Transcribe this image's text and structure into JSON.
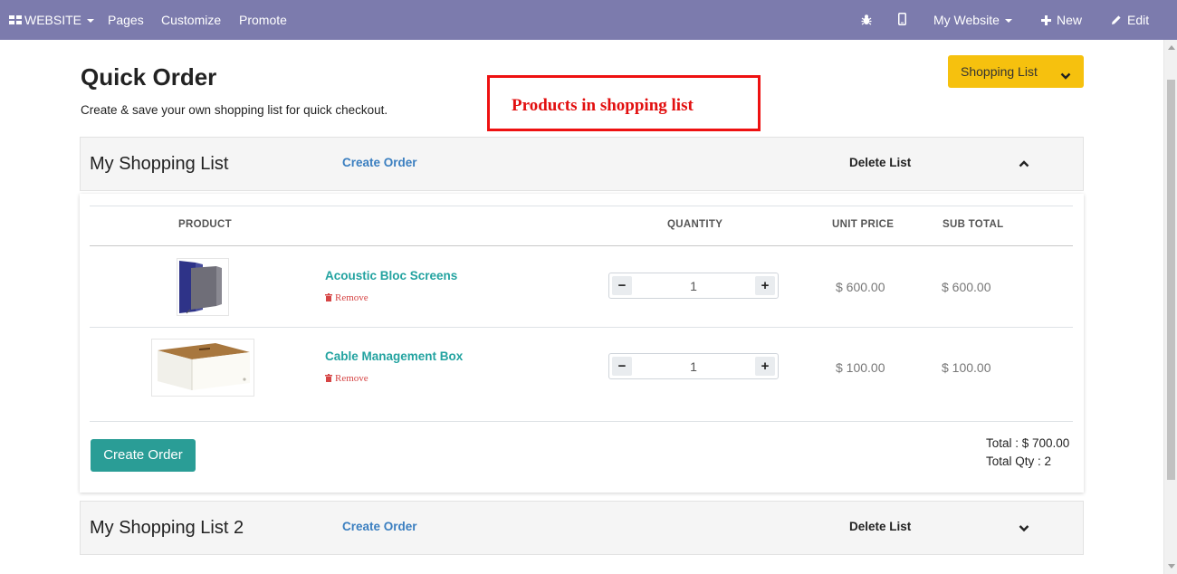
{
  "topbar": {
    "website_label": "WEBSITE",
    "menu": [
      "Pages",
      "Customize",
      "Promote"
    ],
    "my_website": "My Website",
    "new_label": "New",
    "edit_label": "Edit"
  },
  "page": {
    "title": "Quick Order",
    "subtitle": "Create & save your own shopping list for quick checkout.",
    "annotation": "Products in shopping list",
    "shopping_list_button": "Shopping List"
  },
  "lists": [
    {
      "name": "My Shopping List",
      "create_order": "Create Order",
      "delete_list": "Delete List",
      "expanded": true
    },
    {
      "name": "My Shopping List 2",
      "create_order": "Create Order",
      "delete_list": "Delete List",
      "expanded": false
    }
  ],
  "table": {
    "headers": {
      "product": "PRODUCT",
      "quantity": "QUANTITY",
      "unit_price": "UNIT PRICE",
      "sub_total": "SUB TOTAL"
    },
    "rows": [
      {
        "name": "Acoustic Bloc Screens",
        "remove": "Remove",
        "quantity": "1",
        "unit_price": "$ 600.00",
        "sub_total": "$ 600.00",
        "image_icon": "acoustic-screens-image"
      },
      {
        "name": "Cable Management Box",
        "remove": "Remove",
        "quantity": "1",
        "unit_price": "$ 100.00",
        "sub_total": "$ 100.00",
        "image_icon": "cable-box-image"
      }
    ],
    "create_order_button": "Create Order",
    "total": "Total : $ 700.00",
    "total_qty": "Total Qty : 2"
  },
  "colors": {
    "topbar": "#7c7bad",
    "shopping_list_button": "#f6c10e",
    "create_button": "#2a9d96",
    "product_link": "#23a3a0",
    "link": "#3b7fc0",
    "annotation": "#ee1111",
    "remove": "#d64545"
  }
}
